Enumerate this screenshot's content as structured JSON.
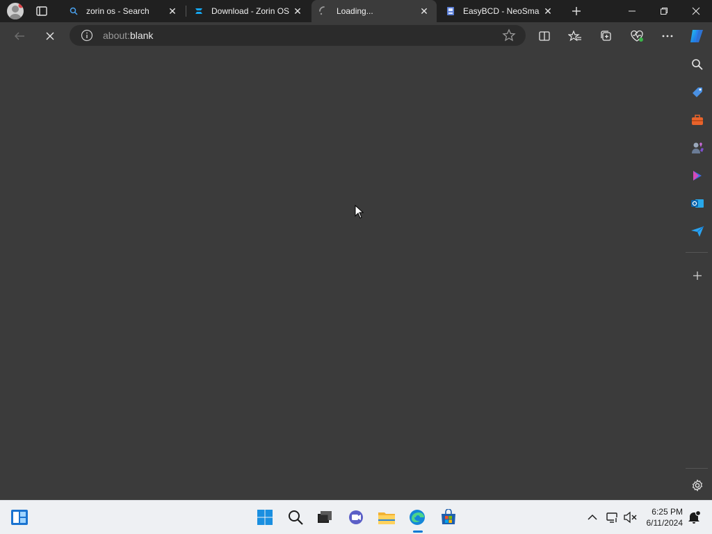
{
  "tabs": [
    {
      "label": "zorin os - Search",
      "icon": "search-icon"
    },
    {
      "label": "Download - Zorin OS",
      "icon": "zorin-logo-icon"
    },
    {
      "label": "Loading...",
      "icon": "loading-spinner-icon"
    },
    {
      "label": "EasyBCD - NeoSmart",
      "icon": "easybcd-icon"
    }
  ],
  "address": {
    "prefix": "about:",
    "value": "blank"
  },
  "clock": {
    "time": "6:25 PM",
    "date": "6/11/2024"
  },
  "colors": {
    "accent": "#0078d4",
    "tabbar": "#202020",
    "content": "#3b3b3b"
  }
}
